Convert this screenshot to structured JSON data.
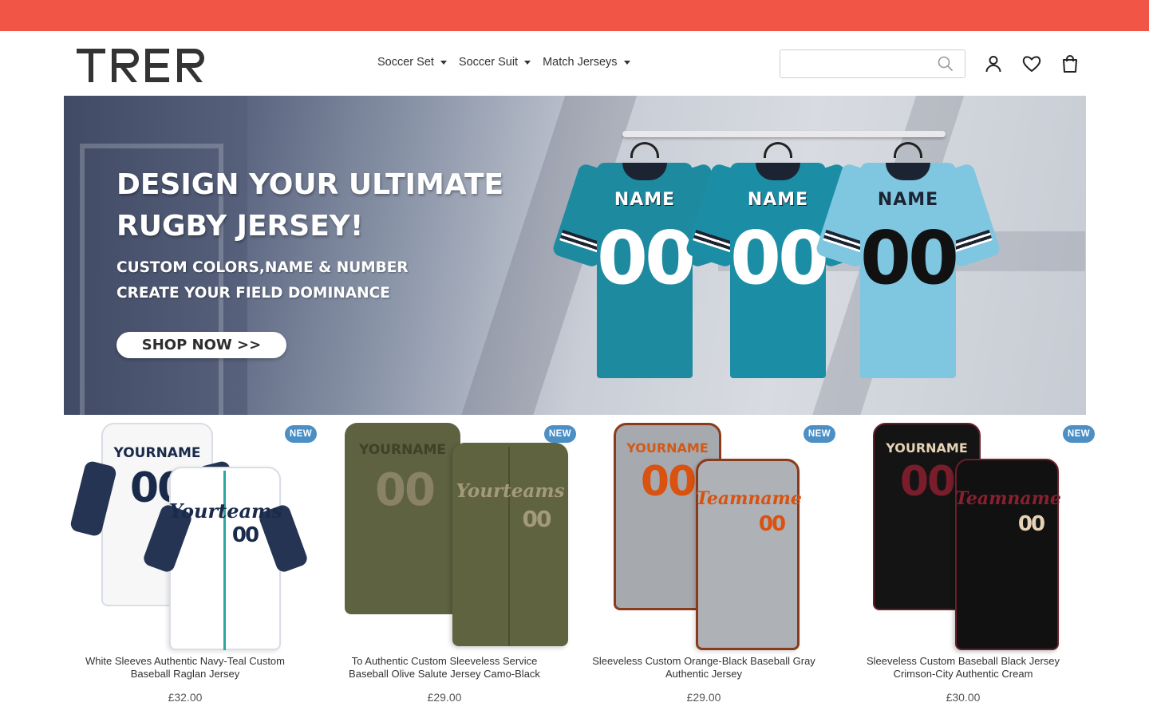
{
  "header": {
    "logo_text": "TRER",
    "nav": [
      {
        "label": "Soccer Set"
      },
      {
        "label": "Soccer Suit"
      },
      {
        "label": "Match Jerseys"
      }
    ],
    "search": {
      "placeholder": "",
      "value": ""
    },
    "icons": [
      "user-icon",
      "heart-icon",
      "shopping-bag-icon"
    ]
  },
  "hero": {
    "title_line1": "DESIGN YOUR ULTIMATE",
    "title_line2": "RUGBY JERSEY!",
    "subtitle_line1": "CUSTOM COLORS,NAME & NUMBER",
    "subtitle_line2": "CREATE YOUR FIELD DOMINANCE",
    "cta_label": "SHOP NOW >>",
    "jerseys": [
      {
        "name": "NAME",
        "number": "00",
        "color": "#1d8aa0"
      },
      {
        "name": "NAME",
        "number": "00",
        "color": "#1b8ea6"
      },
      {
        "name": "NAME",
        "number": "00",
        "color": "#7fc6e0"
      }
    ]
  },
  "products": [
    {
      "badge": "NEW",
      "title": "White Sleeves Authentic Navy-Teal Custom Baseball Raglan Jersey",
      "price": "£32.00",
      "mockup_back_name": "YOURNAME",
      "mockup_back_number": "00",
      "mockup_front_word": "Yourteams",
      "mockup_front_number": "00"
    },
    {
      "badge": "NEW",
      "title": "To Authentic Custom Sleeveless Service Baseball Olive Salute Jersey Camo-Black",
      "price": "£29.00",
      "mockup_back_name": "YOURNAME",
      "mockup_back_number": "00",
      "mockup_front_word": "Yourteams",
      "mockup_front_number": "00"
    },
    {
      "badge": "NEW",
      "title": "Sleeveless Custom Orange-Black Baseball Gray Authentic Jersey",
      "price": "£29.00",
      "mockup_back_name": "YOURNAME",
      "mockup_back_number": "00",
      "mockup_front_word": "Teamname",
      "mockup_front_number": "00"
    },
    {
      "badge": "NEW",
      "title": "Sleeveless Custom Baseball Black Jersey Crimson-City Authentic Cream",
      "price": "£30.00",
      "mockup_back_name": "YOURNAME",
      "mockup_back_number": "00",
      "mockup_front_word": "Teamname",
      "mockup_front_number": "00"
    }
  ],
  "colors": {
    "announcement_bar": "#f05545",
    "badge": "#4b8fc5",
    "text": "#333333"
  }
}
